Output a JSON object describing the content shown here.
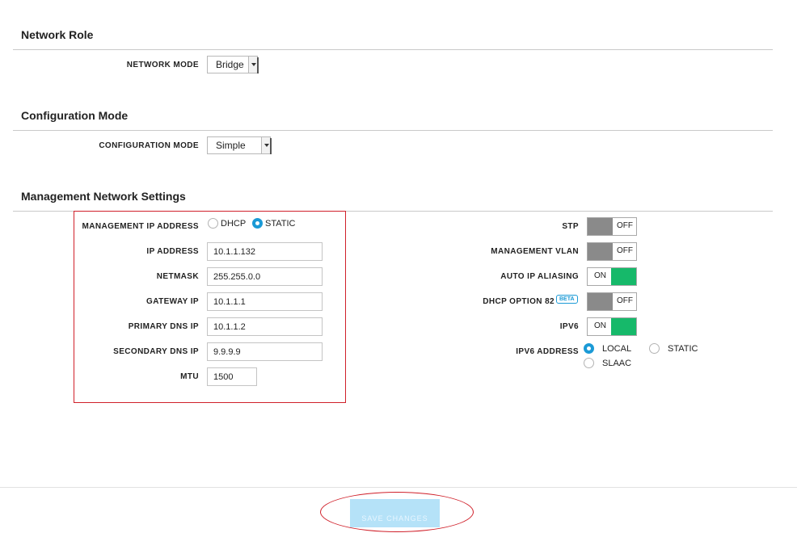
{
  "sections": {
    "network_role": {
      "title": "Network Role"
    },
    "configuration_mode": {
      "title": "Configuration Mode"
    },
    "management": {
      "title": "Management Network Settings"
    }
  },
  "network_mode": {
    "label": "NETWORK MODE",
    "value": "Bridge"
  },
  "configuration_mode": {
    "label": "CONFIGURATION MODE",
    "value": "Simple"
  },
  "mgmt_ip": {
    "label": "MANAGEMENT IP ADDRESS",
    "options": [
      "DHCP",
      "STATIC"
    ],
    "selected": "STATIC"
  },
  "fields": {
    "ip_address": {
      "label": "IP ADDRESS",
      "value": "10.1.1.132"
    },
    "netmask": {
      "label": "NETMASK",
      "value": "255.255.0.0"
    },
    "gateway_ip": {
      "label": "GATEWAY IP",
      "value": "10.1.1.1"
    },
    "primary_dns": {
      "label": "PRIMARY DNS IP",
      "value": "10.1.1.2"
    },
    "secondary_dns": {
      "label": "SECONDARY DNS IP",
      "value": "9.9.9.9"
    },
    "mtu": {
      "label": "MTU",
      "value": "1500"
    }
  },
  "toggles": {
    "stp": {
      "label": "STP",
      "state": "OFF"
    },
    "management_vlan": {
      "label": "MANAGEMENT VLAN",
      "state": "OFF"
    },
    "auto_ip_aliasing": {
      "label": "AUTO IP ALIASING",
      "state": "ON"
    },
    "dhcp_option_82": {
      "label": "DHCP OPTION 82",
      "badge": "BETA",
      "state": "OFF"
    },
    "ipv6": {
      "label": "IPV6",
      "state": "ON"
    }
  },
  "ipv6_address": {
    "label": "IPV6 ADDRESS",
    "options": [
      "LOCAL",
      "STATIC",
      "SLAAC"
    ],
    "selected": "LOCAL"
  },
  "footer": {
    "save_label": "SAVE CHANGES"
  },
  "colors": {
    "accent": "#1b9ad6",
    "toggle_on": "#16b96a",
    "toggle_off": "#8a8a8a",
    "highlight": "#d0202a",
    "save_button": "#b5e2f8"
  }
}
